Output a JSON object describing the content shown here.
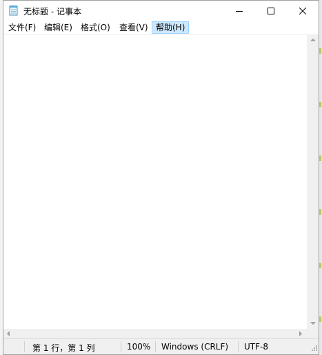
{
  "window": {
    "title": "无标题 - 记事本",
    "app_icon": "notepad-icon",
    "controls": {
      "minimize_icon": "minimize-icon",
      "maximize_icon": "maximize-icon",
      "close_icon": "close-icon"
    }
  },
  "menu": {
    "items": [
      {
        "label": "文件(F)"
      },
      {
        "label": "编辑(E)"
      },
      {
        "label": "格式(O)"
      },
      {
        "label": "查看(V)"
      },
      {
        "label": "帮助(H)"
      }
    ],
    "active_index": 4,
    "active_color": "#cce8ff"
  },
  "editor": {
    "content": ""
  },
  "status": {
    "position": "第 1 行，第 1 列",
    "zoom": "100%",
    "line_ending": "Windows (CRLF)",
    "encoding": "UTF-8"
  },
  "colors": {
    "statusbar_bg": "#f0f0f0",
    "menu_highlight_border": "#99d1ff"
  }
}
